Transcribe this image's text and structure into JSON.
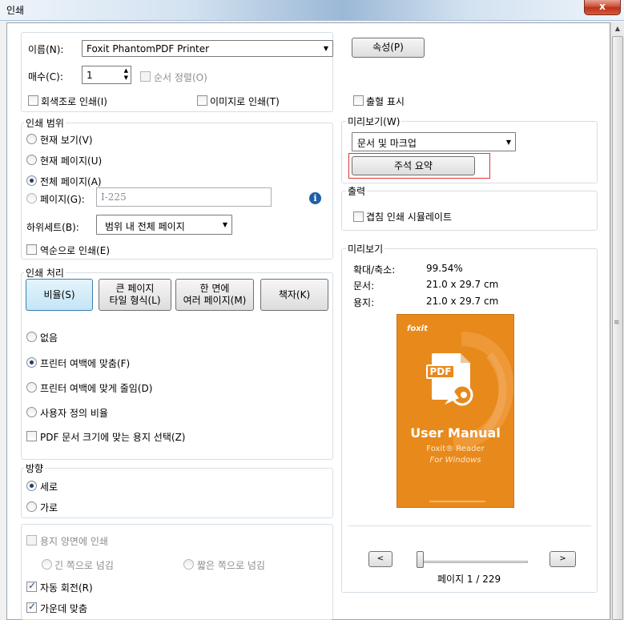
{
  "window": {
    "title": "인쇄",
    "close_label": "x"
  },
  "printer": {
    "name_label": "이름(N):",
    "name_value": "Foxit PhantomPDF Printer",
    "properties_button": "속성(P)",
    "copies_label": "매수(C):",
    "copies_value": "1",
    "collate_label": "순서 정렬(O)",
    "grayscale_label": "회색조로 인쇄(I)",
    "as_image_label": "이미지로 인쇄(T)",
    "bleed_label": "출혈 표시"
  },
  "print_range": {
    "legend": "인쇄 범위",
    "options": [
      "현재 보기(V)",
      "현재 페이지(U)",
      "전체 페이지(A)",
      "페이지(G):"
    ],
    "selected_index": 2,
    "pages_placeholder": "I-225",
    "subset_label": "하위세트(B):",
    "subset_value": "범위 내 전체 페이지",
    "reverse_label": "역순으로 인쇄(E)"
  },
  "print_handling": {
    "legend": "인쇄 처리",
    "buttons": [
      "비율(S)",
      "큰 페이지",
      "타일 형식(L)",
      "한 면에",
      "여러 페이지(M)",
      "책자(K)"
    ],
    "options": [
      "없음",
      "프린터 여백에 맞춤(F)",
      "프린터 여백에 맞게 줄임(D)",
      "사용자 정의 비율"
    ],
    "selected_index": 1,
    "choose_paper_label": "PDF 문서 크기에 맞는 용지 선택(Z)"
  },
  "orientation": {
    "legend": "방향",
    "options": [
      "세로",
      "가로"
    ],
    "selected_index": 0
  },
  "duplex": {
    "duplex_label": "용지 양면에 인쇄",
    "flip_long": "긴 쪽으로 넘김",
    "flip_short": "짧은 쪽으로 넘김",
    "auto_rotate_label": "자동 회전(R)",
    "auto_rotate_checked": true,
    "center_label": "가운데 맞춤",
    "center_checked": true
  },
  "comments": {
    "legend": "미리보기(W)",
    "dropdown_value": "문서 및 마크업",
    "summarize_button": "주석 요약"
  },
  "output": {
    "legend": "출력",
    "simulate_overprint_label": "겹침 인쇄 시뮬레이트"
  },
  "preview": {
    "legend": "미리보기",
    "zoom_label": "확대/축소:",
    "zoom_value": "99.54%",
    "document_label": "문서:",
    "document_value": "21.0 x 29.7 cm",
    "paper_label": "용지:",
    "paper_value": "21.0 x 29.7 cm",
    "prev_button": "<",
    "next_button": ">",
    "page_indicator": "페이지 1 / 229",
    "slider_fraction": 0.0,
    "thumbnail": {
      "brand": "foxit",
      "doc_icon_text": "PDF",
      "title": "User Manual",
      "subtitle": "Foxit® Reader",
      "platform": "For Windows",
      "background_color": "#e8891c"
    }
  },
  "colors": {
    "highlight_border": "#e03434",
    "accent_blue": "#3c7fb1",
    "info_blue": "#1d5fa8"
  }
}
